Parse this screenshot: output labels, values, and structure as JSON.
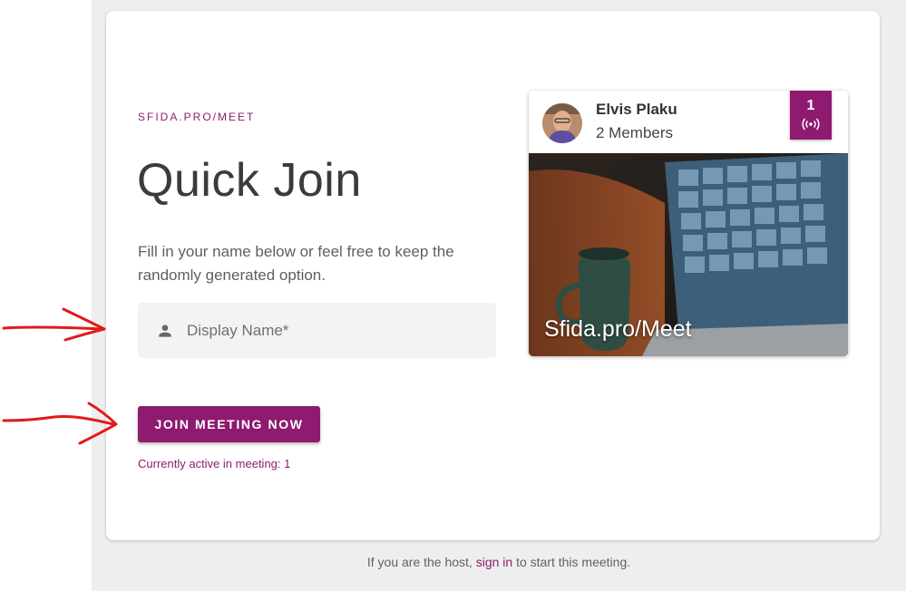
{
  "header": {
    "eyebrow": "SFIDA.PRO/MEET",
    "title": "Quick Join"
  },
  "description": "Fill in your name below or feel free to keep the randomly generated option.",
  "form": {
    "display_name_placeholder": "Display Name*",
    "display_name_value": "",
    "join_button_label": "JOIN MEETING NOW",
    "active_status": "Currently active in meeting: 1"
  },
  "meeting_card": {
    "host_name": "Elvis Plaku",
    "members": "2 Members",
    "badge_count": "1",
    "badge_icon": "broadcast-icon",
    "avatar_icon": "host-avatar",
    "caption": "Sfida.pro/Meet"
  },
  "footer": {
    "prefix": "If you are the host,",
    "link_label": "sign in",
    "suffix": "to start this meeting."
  },
  "colors": {
    "accent": "#8e1b70",
    "page_bg": "#eeeeee",
    "annotation": "#e01b1b"
  }
}
